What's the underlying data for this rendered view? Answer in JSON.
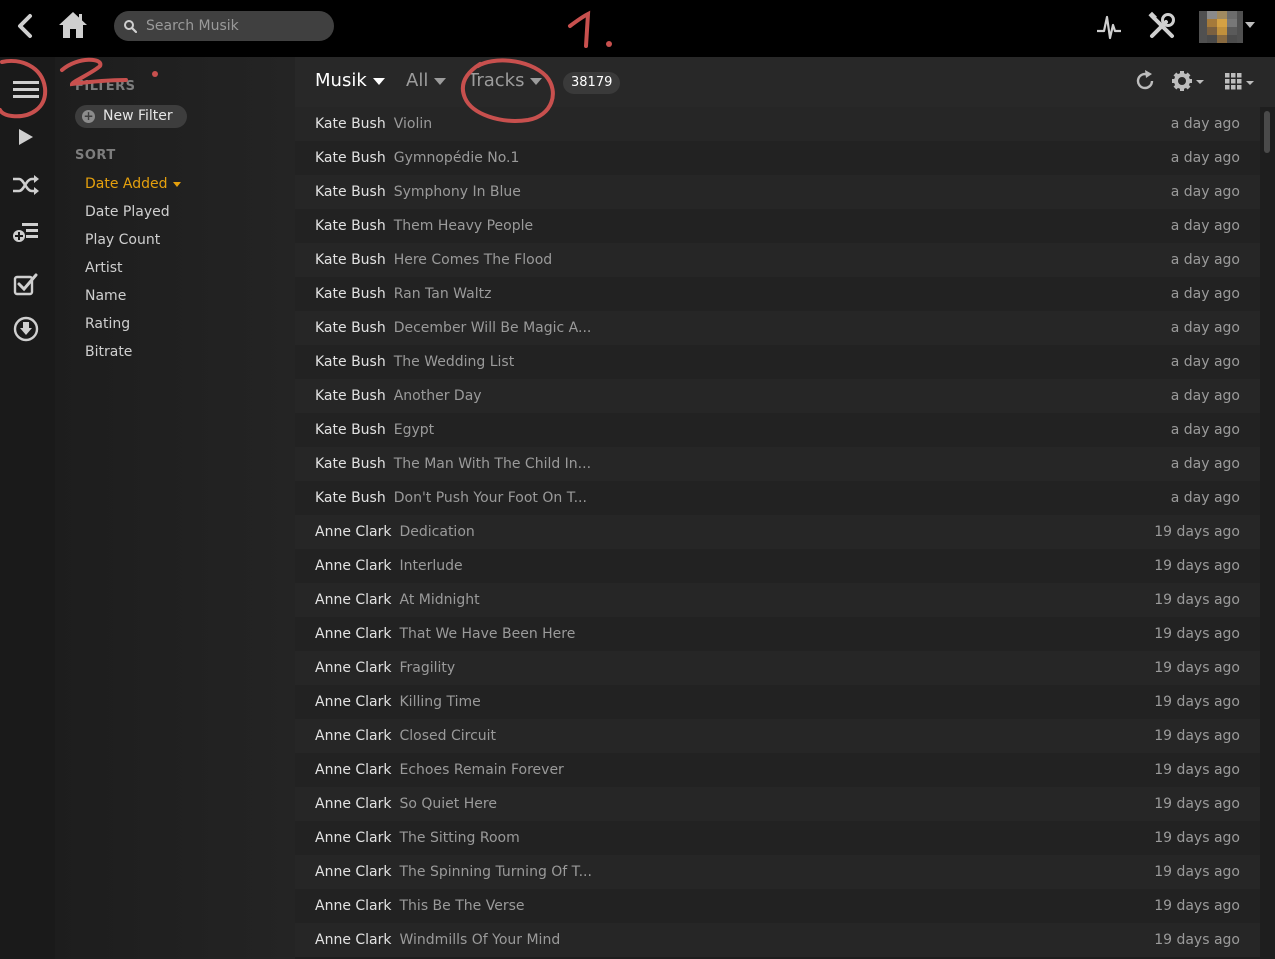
{
  "header": {
    "search_placeholder": "Search Musik"
  },
  "sidebar": {
    "filters_heading": "FILTERS",
    "new_filter_label": "New Filter",
    "sort_heading": "SORT",
    "sort_items": [
      {
        "label": "Date Added",
        "active": true
      },
      {
        "label": "Date Played"
      },
      {
        "label": "Play Count"
      },
      {
        "label": "Artist"
      },
      {
        "label": "Name"
      },
      {
        "label": "Rating"
      },
      {
        "label": "Bitrate"
      }
    ]
  },
  "toolbar": {
    "library": "Musik",
    "filter_all": "All",
    "type": "Tracks",
    "count": "38179"
  },
  "tracks": [
    {
      "artist": "Kate Bush",
      "title": "Violin",
      "added": "a day ago"
    },
    {
      "artist": "Kate Bush",
      "title": "Gymnopédie No.1",
      "added": "a day ago"
    },
    {
      "artist": "Kate Bush",
      "title": "Symphony In Blue",
      "added": "a day ago"
    },
    {
      "artist": "Kate Bush",
      "title": "Them Heavy People",
      "added": "a day ago"
    },
    {
      "artist": "Kate Bush",
      "title": "Here Comes The Flood",
      "added": "a day ago"
    },
    {
      "artist": "Kate Bush",
      "title": "Ran Tan Waltz",
      "added": "a day ago"
    },
    {
      "artist": "Kate Bush",
      "title": "December Will Be Magic A...",
      "added": "a day ago"
    },
    {
      "artist": "Kate Bush",
      "title": "The Wedding List",
      "added": "a day ago"
    },
    {
      "artist": "Kate Bush",
      "title": "Another Day",
      "added": "a day ago"
    },
    {
      "artist": "Kate Bush",
      "title": "Egypt",
      "added": "a day ago"
    },
    {
      "artist": "Kate Bush",
      "title": "The Man With The Child In...",
      "added": "a day ago"
    },
    {
      "artist": "Kate Bush",
      "title": "Don't Push Your Foot On T...",
      "added": "a day ago"
    },
    {
      "artist": "Anne Clark",
      "title": "Dedication",
      "added": "19 days ago"
    },
    {
      "artist": "Anne Clark",
      "title": "Interlude",
      "added": "19 days ago"
    },
    {
      "artist": "Anne Clark",
      "title": "At Midnight",
      "added": "19 days ago"
    },
    {
      "artist": "Anne Clark",
      "title": "That We Have Been Here",
      "added": "19 days ago"
    },
    {
      "artist": "Anne Clark",
      "title": "Fragility",
      "added": "19 days ago"
    },
    {
      "artist": "Anne Clark",
      "title": "Killing Time",
      "added": "19 days ago"
    },
    {
      "artist": "Anne Clark",
      "title": "Closed Circuit",
      "added": "19 days ago"
    },
    {
      "artist": "Anne Clark",
      "title": "Echoes Remain Forever",
      "added": "19 days ago"
    },
    {
      "artist": "Anne Clark",
      "title": "So Quiet Here",
      "added": "19 days ago"
    },
    {
      "artist": "Anne Clark",
      "title": "The Sitting Room",
      "added": "19 days ago"
    },
    {
      "artist": "Anne Clark",
      "title": "The Spinning Turning Of T...",
      "added": "19 days ago"
    },
    {
      "artist": "Anne Clark",
      "title": "This Be The Verse",
      "added": "19 days ago"
    },
    {
      "artist": "Anne Clark",
      "title": "Windmills Of Your Mind",
      "added": "19 days ago"
    }
  ],
  "annotations": {
    "mark_1": "1.",
    "mark_2": "2."
  },
  "colors": {
    "accent": "#e5a00d",
    "annotation": "#c8504e"
  }
}
